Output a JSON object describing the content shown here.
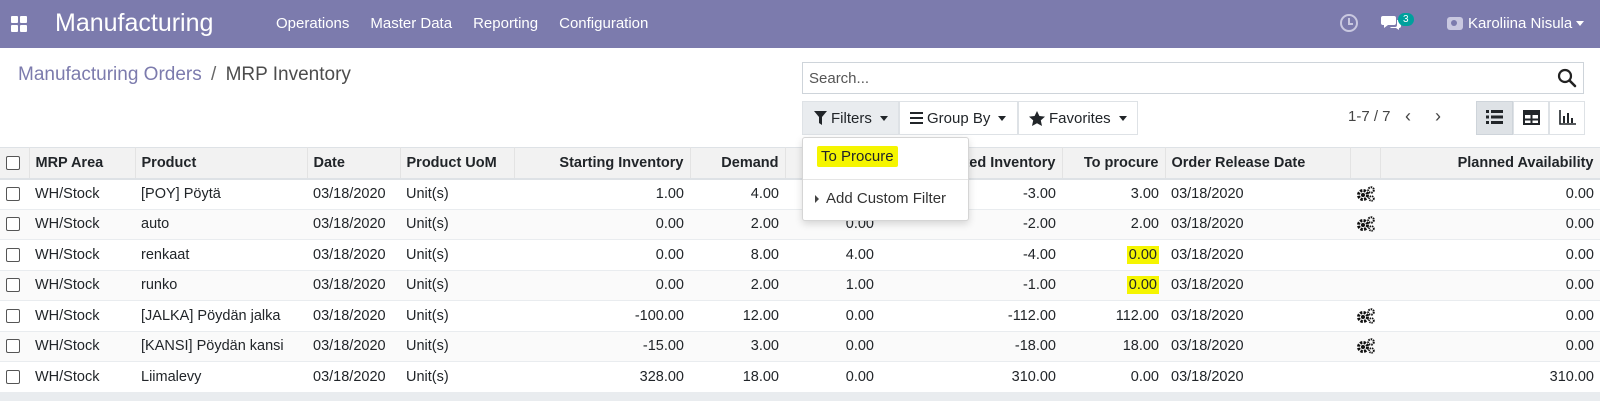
{
  "navbar": {
    "app_title": "Manufacturing",
    "menu": [
      "Operations",
      "Master Data",
      "Reporting",
      "Configuration"
    ],
    "messages_count": "3",
    "user_name": "Karoliina Nisula",
    "bg_color": "#7c7bad"
  },
  "breadcrumb": {
    "parent": "Manufacturing Orders",
    "separator": "/",
    "current": "MRP Inventory"
  },
  "search": {
    "placeholder": "Search..."
  },
  "toolbar": {
    "filters_label": "Filters",
    "groupby_label": "Group By",
    "favorites_label": "Favorites"
  },
  "pager": {
    "range": "1-7 / 7"
  },
  "filters_dropdown": {
    "to_procure": "To Procure",
    "add_custom": "Add Custom Filter"
  },
  "table": {
    "columns": [
      "MRP Area",
      "Product",
      "Date",
      "Product UoM",
      "Starting Inventory",
      "Demand",
      "",
      "ted Inventory",
      "To procure",
      "Order Release Date",
      "",
      "Planned Availability"
    ],
    "rows": [
      {
        "area": "WH/Stock",
        "product": "[POY] Pöytä",
        "date": "03/18/2020",
        "uom": "Unit(s)",
        "start": "1.00",
        "demand": "4.00",
        "supply": "",
        "projected": "-3.00",
        "procure": "3.00",
        "release": "03/18/2020",
        "action": true,
        "planned": "0.00"
      },
      {
        "area": "WH/Stock",
        "product": "auto",
        "date": "03/18/2020",
        "uom": "Unit(s)",
        "start": "0.00",
        "demand": "2.00",
        "supply": "0.00",
        "projected": "-2.00",
        "procure": "2.00",
        "release": "03/18/2020",
        "action": true,
        "planned": "0.00"
      },
      {
        "area": "WH/Stock",
        "product": "renkaat",
        "date": "03/18/2020",
        "uom": "Unit(s)",
        "start": "0.00",
        "demand": "8.00",
        "supply": "4.00",
        "projected": "-4.00",
        "procure": "0.00",
        "release": "03/18/2020",
        "action": false,
        "planned": "0.00"
      },
      {
        "area": "WH/Stock",
        "product": "runko",
        "date": "03/18/2020",
        "uom": "Unit(s)",
        "start": "0.00",
        "demand": "2.00",
        "supply": "1.00",
        "projected": "-1.00",
        "procure": "0.00",
        "release": "03/18/2020",
        "action": false,
        "planned": "0.00"
      },
      {
        "area": "WH/Stock",
        "product": "[JALKA] Pöydän jalka",
        "date": "03/18/2020",
        "uom": "Unit(s)",
        "start": "-100.00",
        "demand": "12.00",
        "supply": "0.00",
        "projected": "-112.00",
        "procure": "112.00",
        "release": "03/18/2020",
        "action": true,
        "planned": "0.00"
      },
      {
        "area": "WH/Stock",
        "product": "[KANSI] Pöydän kansi",
        "date": "03/18/2020",
        "uom": "Unit(s)",
        "start": "-15.00",
        "demand": "3.00",
        "supply": "0.00",
        "projected": "-18.00",
        "procure": "18.00",
        "release": "03/18/2020",
        "action": true,
        "planned": "0.00"
      },
      {
        "area": "WH/Stock",
        "product": "Liimalevy",
        "date": "03/18/2020",
        "uom": "Unit(s)",
        "start": "328.00",
        "demand": "18.00",
        "supply": "0.00",
        "projected": "310.00",
        "procure": "0.00",
        "release": "03/18/2020",
        "action": false,
        "planned": "310.00"
      }
    ],
    "highlighted_procure_rows": [
      2,
      3
    ],
    "highlight_color": "#f5f500"
  }
}
